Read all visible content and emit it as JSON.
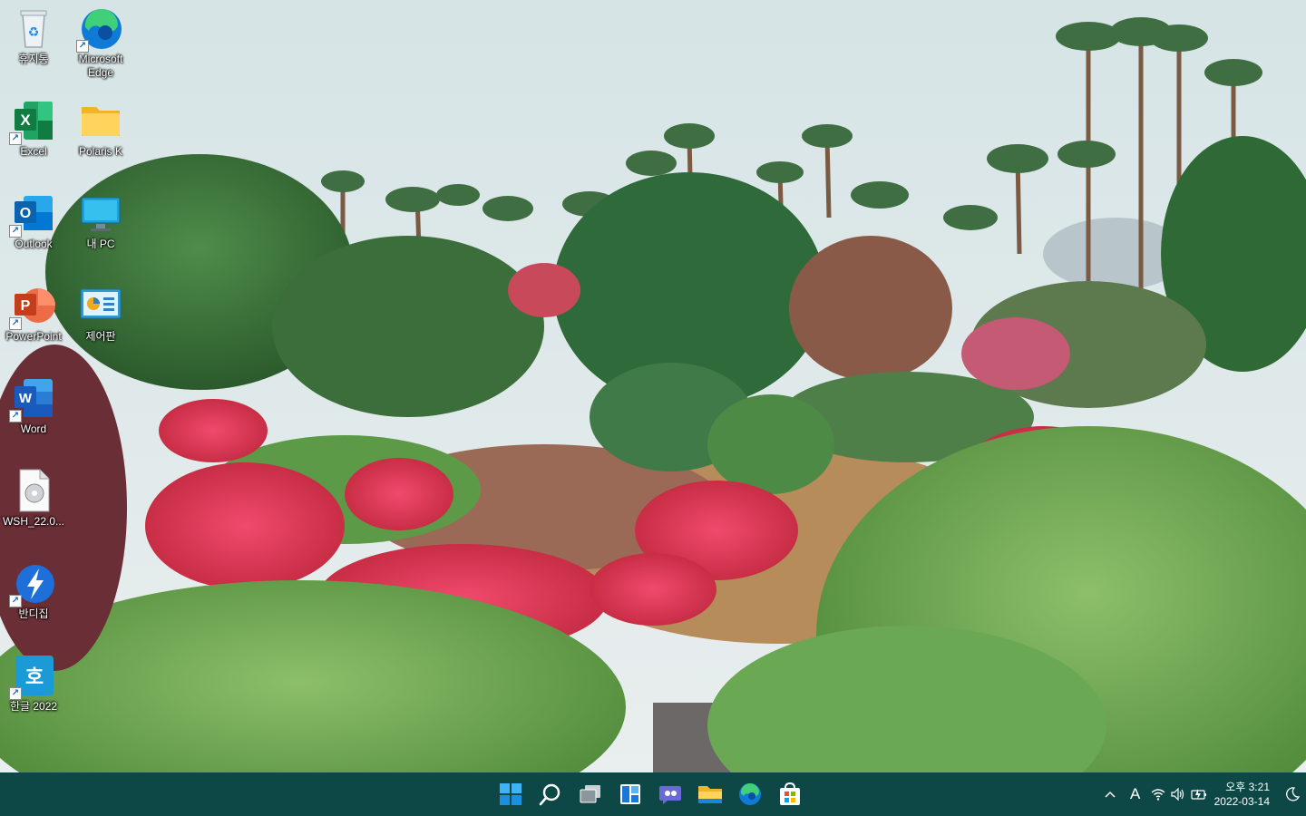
{
  "desktop": {
    "icons": [
      {
        "label": "휴지통",
        "icon": "recycle-bin-icon"
      },
      {
        "label": "Microsoft Edge",
        "icon": "edge-icon"
      },
      {
        "label": "Excel",
        "icon": "excel-icon"
      },
      {
        "label": "Polaris K",
        "icon": "folder-icon"
      },
      {
        "label": "Outlook",
        "icon": "outlook-icon"
      },
      {
        "label": "내 PC",
        "icon": "monitor-icon"
      },
      {
        "label": "PowerPoint",
        "icon": "powerpoint-icon"
      },
      {
        "label": "제어판",
        "icon": "control-panel-icon"
      },
      {
        "label": "Word",
        "icon": "word-icon"
      },
      {
        "label": "WSH_22.0...",
        "icon": "file-icon"
      },
      {
        "label": "반디집",
        "icon": "bandizip-icon"
      },
      {
        "label": "한글 2022",
        "icon": "hangul-icon"
      }
    ]
  },
  "taskbar": {
    "apps": [
      "start-icon",
      "search-icon",
      "task-view-icon",
      "widgets-icon",
      "chat-icon",
      "file-explorer-icon",
      "edge-icon",
      "store-icon"
    ],
    "tray": {
      "ime": "A",
      "time": "오후 3:21",
      "date": "2022-03-14"
    }
  },
  "colors": {
    "taskbar": "#0d4746",
    "accent": "#0078d4"
  }
}
